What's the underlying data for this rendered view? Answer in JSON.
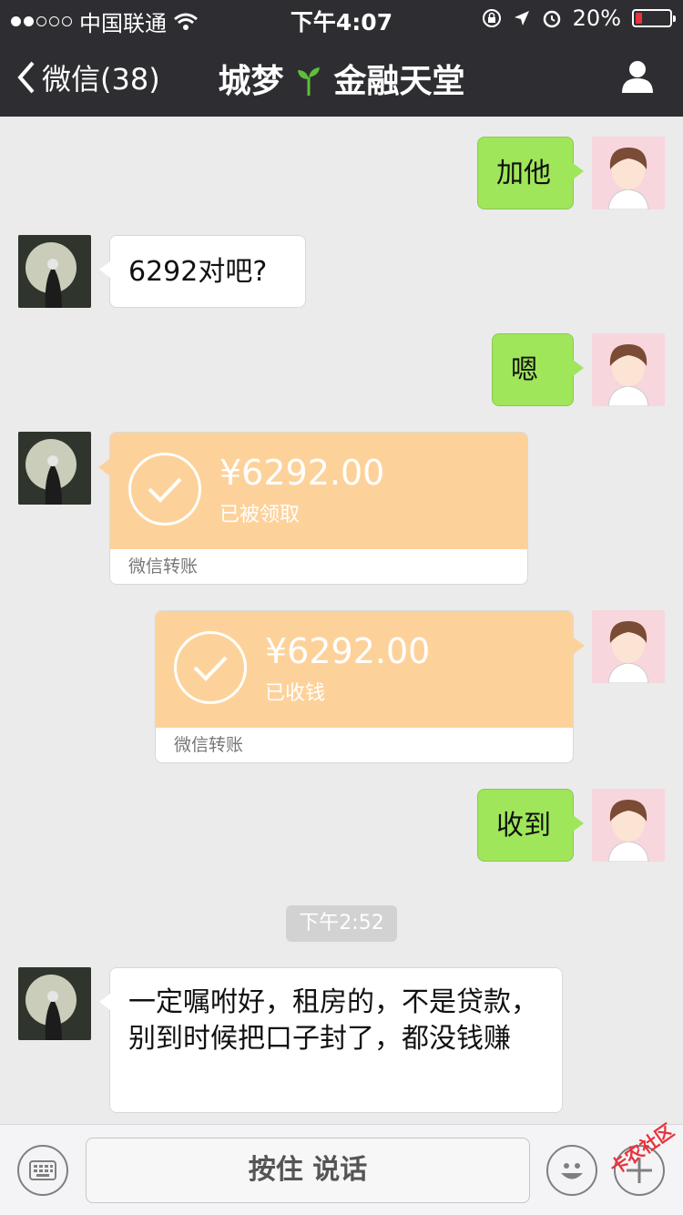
{
  "status_bar": {
    "carrier": "中国联通",
    "time": "下午4:07",
    "battery": "20%",
    "battery_level": 0.2
  },
  "nav": {
    "back_label": "微信(38)",
    "title_part1": "城梦",
    "title_part2": "金融天堂"
  },
  "messages": {
    "m1": "加他",
    "m2": "6292对吧?",
    "m3": "嗯",
    "t1": {
      "amount": "¥6292.00",
      "status": "已被领取",
      "footer": "微信转账"
    },
    "t2": {
      "amount": "¥6292.00",
      "status": "已收钱",
      "footer": "微信转账"
    },
    "m4": "收到",
    "timestamp": "下午2:52",
    "m5": "一定嘱咐好，租房的，不是贷款，别到时候把口子封了，都没钱赚"
  },
  "input_bar": {
    "hold_to_talk": "按住 说话"
  },
  "watermark": "卡农社区"
}
